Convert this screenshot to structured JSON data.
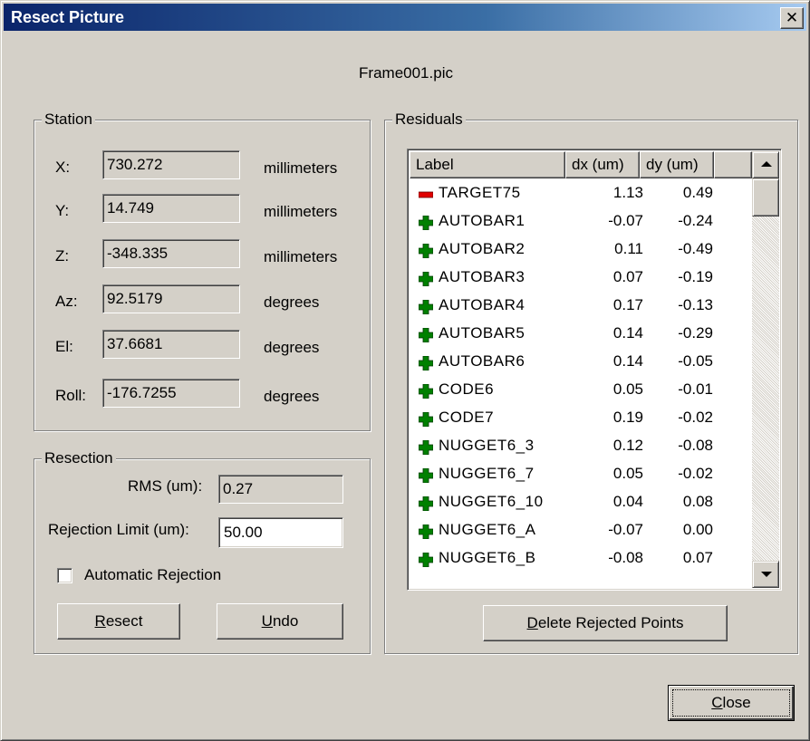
{
  "window": {
    "title": "Resect Picture",
    "close_glyph": "✕"
  },
  "filename": "Frame001.pic",
  "station": {
    "group_label": "Station",
    "fields": [
      {
        "label": "X:",
        "value": "730.272",
        "unit": "millimeters"
      },
      {
        "label": "Y:",
        "value": "14.749",
        "unit": "millimeters"
      },
      {
        "label": "Z:",
        "value": "-348.335",
        "unit": "millimeters"
      },
      {
        "label": "Az:",
        "value": "92.5179",
        "unit": "degrees"
      },
      {
        "label": "El:",
        "value": "37.6681",
        "unit": "degrees"
      },
      {
        "label": "Roll:",
        "value": "-176.7255",
        "unit": "degrees"
      }
    ]
  },
  "resection": {
    "group_label": "Resection",
    "rms_label": "RMS (um):",
    "rms_value": "0.27",
    "rejection_label": "Rejection Limit (um):",
    "rejection_value": "50.00",
    "auto_reject_label": "Automatic Rejection",
    "auto_reject_checked": false,
    "resect_button": {
      "label": "Resect",
      "accel": "R"
    },
    "undo_button": {
      "label": "Undo",
      "accel": "U"
    }
  },
  "residuals": {
    "group_label": "Residuals",
    "columns": [
      "Label",
      "dx (um)",
      "dy (um)"
    ],
    "rows": [
      {
        "status": "rejected",
        "label": "TARGET75",
        "dx": "1.13",
        "dy": "0.49"
      },
      {
        "status": "accepted",
        "label": "AUTOBAR1",
        "dx": "-0.07",
        "dy": "-0.24"
      },
      {
        "status": "accepted",
        "label": "AUTOBAR2",
        "dx": "0.11",
        "dy": "-0.49"
      },
      {
        "status": "accepted",
        "label": "AUTOBAR3",
        "dx": "0.07",
        "dy": "-0.19"
      },
      {
        "status": "accepted",
        "label": "AUTOBAR4",
        "dx": "0.17",
        "dy": "-0.13"
      },
      {
        "status": "accepted",
        "label": "AUTOBAR5",
        "dx": "0.14",
        "dy": "-0.29"
      },
      {
        "status": "accepted",
        "label": "AUTOBAR6",
        "dx": "0.14",
        "dy": "-0.05"
      },
      {
        "status": "accepted",
        "label": "CODE6",
        "dx": "0.05",
        "dy": "-0.01"
      },
      {
        "status": "accepted",
        "label": "CODE7",
        "dx": "0.19",
        "dy": "-0.02"
      },
      {
        "status": "accepted",
        "label": "NUGGET6_3",
        "dx": "0.12",
        "dy": "-0.08"
      },
      {
        "status": "accepted",
        "label": "NUGGET6_7",
        "dx": "0.05",
        "dy": "-0.02"
      },
      {
        "status": "accepted",
        "label": "NUGGET6_10",
        "dx": "0.04",
        "dy": "0.08"
      },
      {
        "status": "accepted",
        "label": "NUGGET6_A",
        "dx": "-0.07",
        "dy": "0.00"
      },
      {
        "status": "accepted",
        "label": "NUGGET6_B",
        "dx": "-0.08",
        "dy": "0.07"
      }
    ],
    "delete_button": {
      "label": "Delete Rejected Points",
      "accel": "D"
    }
  },
  "close_button": {
    "label": "Close",
    "accel": "C"
  },
  "icons": {
    "accepted": "plus-icon",
    "rejected": "minus-icon",
    "accepted_color": "#008000",
    "rejected_color": "#e00000"
  },
  "colors": {
    "face": "#d4d0c8",
    "title_start": "#0a246a",
    "title_end": "#a6caf0"
  }
}
